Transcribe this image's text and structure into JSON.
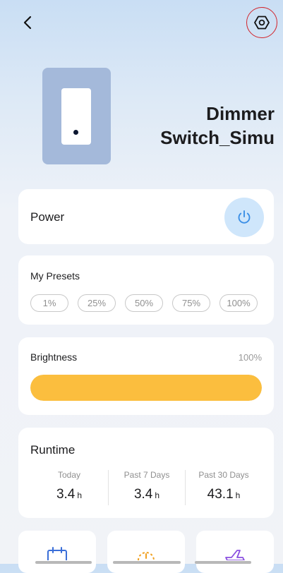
{
  "device": {
    "name": "Dimmer Switch_Simu"
  },
  "power": {
    "label": "Power"
  },
  "presets": {
    "title": "My Presets",
    "items": [
      "1%",
      "25%",
      "50%",
      "75%",
      "100%"
    ]
  },
  "brightness": {
    "title": "Brightness",
    "value_label": "100%",
    "level": 1.0
  },
  "runtime": {
    "title": "Runtime",
    "columns": [
      {
        "label": "Today",
        "value": "3.4",
        "unit": "h"
      },
      {
        "label": "Past 7 Days",
        "value": "3.4",
        "unit": "h"
      },
      {
        "label": "Past 30 Days",
        "value": "43.1",
        "unit": "h"
      }
    ]
  },
  "tiles": [
    {
      "icon": "schedule-icon",
      "color": "#3b6fd8"
    },
    {
      "icon": "timer-gauge-icon",
      "color": "#f0a020"
    },
    {
      "icon": "away-mode-plane-icon",
      "color": "#8a4fe0"
    }
  ],
  "colors": {
    "accent": "#fbbe3e",
    "power_button": "#cfe6fb",
    "power_icon": "#3b8fe6",
    "device_plate": "#a4b9da"
  }
}
